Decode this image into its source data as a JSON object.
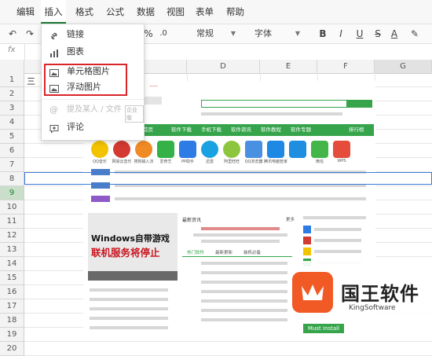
{
  "menu": {
    "items": [
      "编辑",
      "插入",
      "格式",
      "公式",
      "数据",
      "视图",
      "表单",
      "帮助"
    ],
    "active_index": 1
  },
  "toolbar": {
    "percent_label": "%",
    "decimals_label": ".0",
    "number_format": "常规",
    "font_label": "字体",
    "bold_label": "B",
    "italic_label": "I",
    "underline_label": "U",
    "strike_label": "S",
    "fontcolor_label": "A"
  },
  "formula_bar": {
    "fx_label": "fx"
  },
  "grid": {
    "columns": [
      "D",
      "E",
      "F",
      "G"
    ],
    "selected_column": "G",
    "rows": [
      "1",
      "2",
      "3",
      "4",
      "5",
      "6",
      "7",
      "8",
      "9",
      "10",
      "11",
      "12",
      "13",
      "14",
      "15",
      "16",
      "17",
      "18",
      "19",
      "20"
    ],
    "selected_row": "9",
    "a1_value": "三"
  },
  "insert_menu": {
    "items": [
      {
        "label": "链接",
        "icon": "link-icon"
      },
      {
        "label": "图表",
        "icon": "chart-icon"
      },
      {
        "label": "单元格图片",
        "icon": "cell-image-icon"
      },
      {
        "label": "浮动图片",
        "icon": "floating-image-icon"
      },
      {
        "label": "提及某人 / 文件",
        "icon": "at-icon",
        "badge": "企业版"
      },
      {
        "label": "评论",
        "icon": "comment-icon"
      }
    ]
  },
  "embedded": {
    "nav": [
      "首页",
      "软件下载",
      "手机下载",
      "软件资讯",
      "软件教程",
      "软件专题",
      "排行榜"
    ],
    "apps": [
      "QQ音乐",
      "网易云音乐",
      "搜狗输入法",
      "爱奇艺",
      "PP助手",
      "迅雷",
      "阿里旺旺",
      "QQ浏览器",
      "腾讯电脑管家",
      "微信",
      "WPS"
    ],
    "banner_line1": "Windows自带游戏",
    "banner_line2": "联机服务将停止",
    "section_title": "最新资讯",
    "section_more": "更多",
    "tabs": [
      "热门软件",
      "最新更新",
      "装机必备"
    ]
  },
  "logo": {
    "name": "国王软件",
    "sub": "KingSoftware",
    "button": "Must Install",
    "brand_color": "#f15a24"
  }
}
